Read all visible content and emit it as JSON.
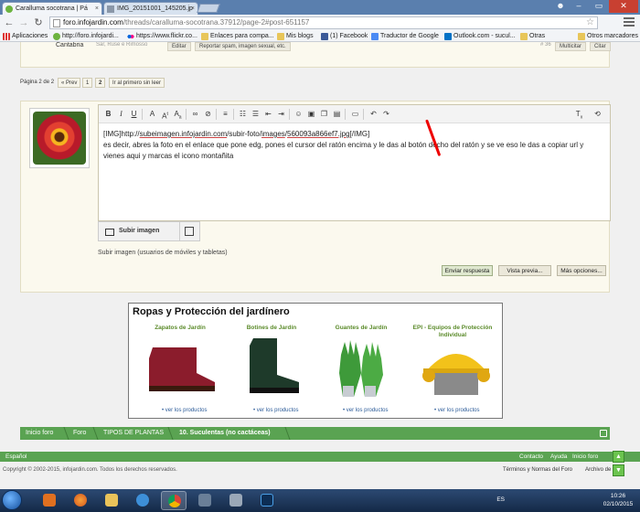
{
  "browser": {
    "tabs": [
      {
        "title": "Caralluma socotrana | Pá",
        "active": true
      },
      {
        "title": "IMG_20151001_145205.jp",
        "active": false
      }
    ],
    "url_host": "foro.infojardin.com",
    "url_path": "/threads/caralluma-socotrana.37912/page-2#post-651157",
    "bookmarks": [
      "Aplicaciones",
      "http://foro.infojardi...",
      "https://www.flickr.co...",
      "Enlaces para compa...",
      "Mis blogs",
      "(1) Facebook",
      "Traductor de Google",
      "Outlook.com - sucul...",
      "Otras",
      "Otros marcadores"
    ]
  },
  "prev_post": {
    "location": "Cantabria",
    "buttons": [
      "Editar",
      "Reportar spam, imagen sexual, etc.",
      "Multicitar",
      "Citar"
    ],
    "faded_left": "Sar, Ruse e Rimosso",
    "faded_right": "# 36"
  },
  "pager": {
    "label": "Página 2 de 2",
    "prev": "« Prev",
    "p1": "1",
    "p2": "2",
    "first_unread": "Ir al primero sin leer"
  },
  "editor": {
    "line1_prefix": "[IMG]http://",
    "line1_host": "subeimagen.infojardin.com",
    "line1_mid": "/subir-foto/",
    "line1_images": "images",
    "line1_slash": "/",
    "line1_file": "560093a866ef7.jpg",
    "line1_end": "[/IMG]",
    "line2": "es decir, abres la foto en el enlace que pone edg, pones el cursor del ratón encima y le das al botón decho del ratón y se ve eso le das a copiar url y vienes aqui y marcas el icono montañita",
    "upload_label": "Subir imagen",
    "mobile_link": "Subir imagen (usuarios de móviles y tabletas)",
    "send": "Enviar respuesta",
    "preview": "Vista previa...",
    "more": "Más opciones..."
  },
  "ad": {
    "title": "Ropas y Protección del jardínero",
    "items": [
      {
        "name": "Zapatos de Jardín",
        "more": "• ver los productos"
      },
      {
        "name": "Botines de Jardín",
        "more": "• ver los productos"
      },
      {
        "name": "Guantes de Jardín",
        "more": "• ver los productos"
      },
      {
        "name": "EPI - Equipos de Protección Individual",
        "more": "• ver los productos"
      }
    ]
  },
  "breadcrumbs": [
    "Inicio foro",
    "Foro",
    "TIPOS DE PLANTAS",
    "10. Suculentas (no cactáceas)"
  ],
  "footer": {
    "language": "Español",
    "links": [
      "Contacto",
      "Ayuda",
      "Inicio foro"
    ],
    "copyright": "Copyright © 2002-2015, infojardin.com. Todos los derechos reservados.",
    "terms": "Términos y Normas del Foro",
    "archive": "Archivo de"
  },
  "taskbar": {
    "lang": "ES",
    "time": "10:26",
    "date": "02/10/2015"
  },
  "colors": {
    "green_bar": "#5aa352",
    "post_bg": "#fbf9ee",
    "chrome_frame": "#5a7fae"
  }
}
